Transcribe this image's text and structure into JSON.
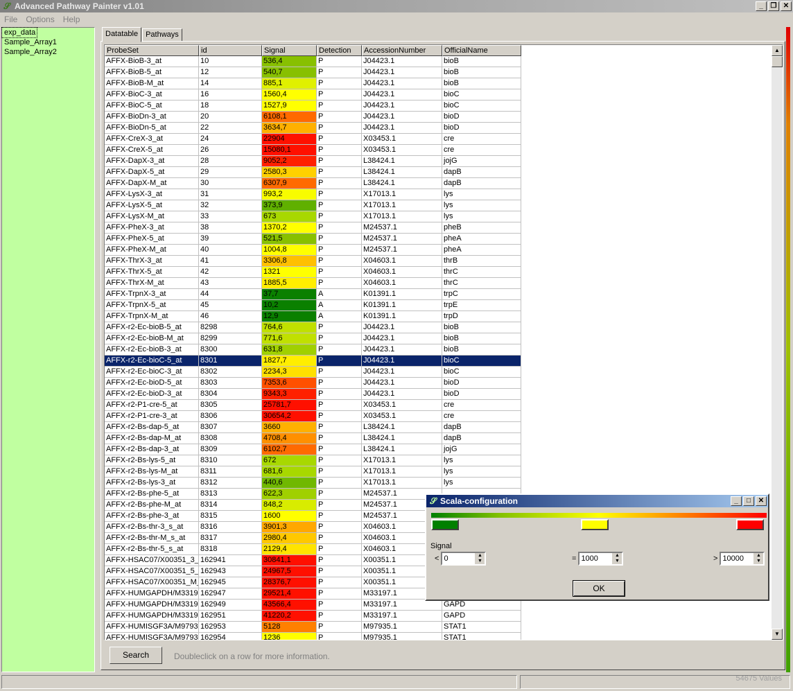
{
  "window": {
    "title": "Advanced Pathway Painter v1.01",
    "minimize": "_",
    "restore": "❐",
    "close": "✕"
  },
  "menu": [
    "File",
    "Options",
    "Help"
  ],
  "datasets": [
    "exp_data",
    "Sample_Array1",
    "Sample_Array2"
  ],
  "tabs": [
    "Datatable",
    "Pathways"
  ],
  "table": {
    "columns": [
      "ProbeSet",
      "id",
      "Signal",
      "Detection",
      "AccessionNumber",
      "OfficialName"
    ],
    "selected_row": 27,
    "rows": [
      [
        "AFFX-BioB-3_at",
        "10",
        "536,4",
        "P",
        "J04423.1",
        "bioB",
        "#88c000"
      ],
      [
        "AFFX-BioB-5_at",
        "12",
        "540,7",
        "P",
        "J04423.1",
        "bioB",
        "#88c000"
      ],
      [
        "AFFX-BioB-M_at",
        "14",
        "885,1",
        "P",
        "J04423.1",
        "bioB",
        "#e0f000"
      ],
      [
        "AFFX-BioC-3_at",
        "16",
        "1560,4",
        "P",
        "J04423.1",
        "bioC",
        "#ffff00"
      ],
      [
        "AFFX-BioC-5_at",
        "18",
        "1527,9",
        "P",
        "J04423.1",
        "bioC",
        "#ffff00"
      ],
      [
        "AFFX-BioDn-3_at",
        "20",
        "6108,1",
        "P",
        "J04423.1",
        "bioD",
        "#ff6a00"
      ],
      [
        "AFFX-BioDn-5_at",
        "22",
        "3634,7",
        "P",
        "J04423.1",
        "bioD",
        "#ffb000"
      ],
      [
        "AFFX-CreX-3_at",
        "24",
        "22904",
        "P",
        "X03453.1",
        "cre",
        "#ff1000"
      ],
      [
        "AFFX-CreX-5_at",
        "26",
        "15080,1",
        "P",
        "X03453.1",
        "cre",
        "#ff1000"
      ],
      [
        "AFFX-DapX-3_at",
        "28",
        "9052,2",
        "P",
        "L38424.1",
        "jojG",
        "#ff2000"
      ],
      [
        "AFFX-DapX-5_at",
        "29",
        "2580,3",
        "P",
        "L38424.1",
        "dapB",
        "#ffd000"
      ],
      [
        "AFFX-DapX-M_at",
        "30",
        "6307,9",
        "P",
        "L38424.1",
        "dapB",
        "#ff6a00"
      ],
      [
        "AFFX-LysX-3_at",
        "31",
        "993,2",
        "P",
        "X17013.1",
        "lys",
        "#f8fc00"
      ],
      [
        "AFFX-LysX-5_at",
        "32",
        "373,9",
        "P",
        "X17013.1",
        "lys",
        "#60b000"
      ],
      [
        "AFFX-LysX-M_at",
        "33",
        "673",
        "P",
        "X17013.1",
        "lys",
        "#a8d800"
      ],
      [
        "AFFX-PheX-3_at",
        "38",
        "1370,2",
        "P",
        "M24537.1",
        "pheB",
        "#ffff00"
      ],
      [
        "AFFX-PheX-5_at",
        "39",
        "521,5",
        "P",
        "M24537.1",
        "pheA",
        "#88c000"
      ],
      [
        "AFFX-PheX-M_at",
        "40",
        "1004,8",
        "P",
        "M24537.1",
        "pheA",
        "#ffff00"
      ],
      [
        "AFFX-ThrX-3_at",
        "41",
        "3306,8",
        "P",
        "X04603.1",
        "thrB",
        "#ffc000"
      ],
      [
        "AFFX-ThrX-5_at",
        "42",
        "1321",
        "P",
        "X04603.1",
        "thrC",
        "#ffff00"
      ],
      [
        "AFFX-ThrX-M_at",
        "43",
        "1885,5",
        "P",
        "X04603.1",
        "thrC",
        "#ffee00"
      ],
      [
        "AFFX-TrpnX-3_at",
        "44",
        "37,7",
        "A",
        "K01391.1",
        "trpC",
        "#0a8000"
      ],
      [
        "AFFX-TrpnX-5_at",
        "45",
        "10,2",
        "A",
        "K01391.1",
        "trpE",
        "#0a8000"
      ],
      [
        "AFFX-TrpnX-M_at",
        "46",
        "12,9",
        "A",
        "K01391.1",
        "trpD",
        "#0a8000"
      ],
      [
        "AFFX-r2-Ec-bioB-5_at",
        "8298",
        "764,6",
        "P",
        "J04423.1",
        "bioB",
        "#c0e000"
      ],
      [
        "AFFX-r2-Ec-bioB-M_at",
        "8299",
        "771,6",
        "P",
        "J04423.1",
        "bioB",
        "#c0e000"
      ],
      [
        "AFFX-r2-Ec-bioB-3_at",
        "8300",
        "631,8",
        "P",
        "J04423.1",
        "bioB",
        "#a0d000"
      ],
      [
        "AFFX-r2-Ec-bioC-5_at",
        "8301",
        "1827,7",
        "P",
        "J04423.1",
        "bioC",
        "#ffee00"
      ],
      [
        "AFFX-r2-Ec-bioC-3_at",
        "8302",
        "2234,3",
        "P",
        "J04423.1",
        "bioC",
        "#ffe000"
      ],
      [
        "AFFX-r2-Ec-bioD-5_at",
        "8303",
        "7353,6",
        "P",
        "J04423.1",
        "bioD",
        "#ff5000"
      ],
      [
        "AFFX-r2-Ec-bioD-3_at",
        "8304",
        "9343,3",
        "P",
        "J04423.1",
        "bioD",
        "#ff2000"
      ],
      [
        "AFFX-r2-P1-cre-5_at",
        "8305",
        "25781,7",
        "P",
        "X03453.1",
        "cre",
        "#ff1000"
      ],
      [
        "AFFX-r2-P1-cre-3_at",
        "8306",
        "30654,2",
        "P",
        "X03453.1",
        "cre",
        "#ff1000"
      ],
      [
        "AFFX-r2-Bs-dap-5_at",
        "8307",
        "3660",
        "P",
        "L38424.1",
        "dapB",
        "#ffb000"
      ],
      [
        "AFFX-r2-Bs-dap-M_at",
        "8308",
        "4708,4",
        "P",
        "L38424.1",
        "dapB",
        "#ff9000"
      ],
      [
        "AFFX-r2-Bs-dap-3_at",
        "8309",
        "6102,7",
        "P",
        "L38424.1",
        "jojG",
        "#ff6a00"
      ],
      [
        "AFFX-r2-Bs-lys-5_at",
        "8310",
        "672",
        "P",
        "X17013.1",
        "lys",
        "#a8d800"
      ],
      [
        "AFFX-r2-Bs-lys-M_at",
        "8311",
        "681,6",
        "P",
        "X17013.1",
        "lys",
        "#a8d800"
      ],
      [
        "AFFX-r2-Bs-lys-3_at",
        "8312",
        "440,6",
        "P",
        "X17013.1",
        "lys",
        "#70b800"
      ],
      [
        "AFFX-r2-Bs-phe-5_at",
        "8313",
        "622,3",
        "P",
        "M24537.1",
        "",
        "#a0d000"
      ],
      [
        "AFFX-r2-Bs-phe-M_at",
        "8314",
        "848,2",
        "P",
        "M24537.1",
        "",
        "#d8ec00"
      ],
      [
        "AFFX-r2-Bs-phe-3_at",
        "8315",
        "1600",
        "P",
        "M24537.1",
        "",
        "#ffff00"
      ],
      [
        "AFFX-r2-Bs-thr-3_s_at",
        "8316",
        "3901,3",
        "P",
        "X04603.1",
        "",
        "#ffa800"
      ],
      [
        "AFFX-r2-Bs-thr-M_s_at",
        "8317",
        "2980,4",
        "P",
        "X04603.1",
        "",
        "#ffc800"
      ],
      [
        "AFFX-r2-Bs-thr-5_s_at",
        "8318",
        "2129,4",
        "P",
        "X04603.1",
        "",
        "#ffe400"
      ],
      [
        "AFFX-HSAC07/X00351_3_at",
        "162941",
        "30841,1",
        "P",
        "X00351.1",
        "",
        "#ff1000"
      ],
      [
        "AFFX-HSAC07/X00351_5_at",
        "162943",
        "24967,5",
        "P",
        "X00351.1",
        "",
        "#ff1000"
      ],
      [
        "AFFX-HSAC07/X00351_M_at",
        "162945",
        "28376,7",
        "P",
        "X00351.1",
        "",
        "#ff1000"
      ],
      [
        "AFFX-HUMGAPDH/M33197_3_at",
        "162947",
        "29521,4",
        "P",
        "M33197.1",
        "",
        "#ff1000"
      ],
      [
        "AFFX-HUMGAPDH/M33197_5_at",
        "162949",
        "43566,4",
        "P",
        "M33197.1",
        "GAPD",
        "#ff1000"
      ],
      [
        "AFFX-HUMGAPDH/M33197_M_at",
        "162951",
        "41220,2",
        "P",
        "M33197.1",
        "GAPD",
        "#ff1000"
      ],
      [
        "AFFX-HUMISGF3A/M97935_3_at",
        "162953",
        "5128",
        "P",
        "M97935.1",
        "STAT1",
        "#ff8000"
      ],
      [
        "AFFX-HUMISGF3A/M97935_5_at",
        "162954",
        "1236",
        "P",
        "M97935.1",
        "STAT1",
        "#ffff00"
      ]
    ]
  },
  "search_label": "Search",
  "hint": "Doubleclick on a row for more information.",
  "value_count": "54675 Values",
  "dialog": {
    "title": "Scala-configuration",
    "low_color": "#008000",
    "mid_color": "#ffff00",
    "high_color": "#ff0000",
    "signal_label": "Signal",
    "low_op": "<",
    "low_value": "0",
    "mid_op": "=",
    "mid_value": "1000",
    "high_op": ">",
    "high_value": "10000",
    "ok_label": "OK"
  }
}
